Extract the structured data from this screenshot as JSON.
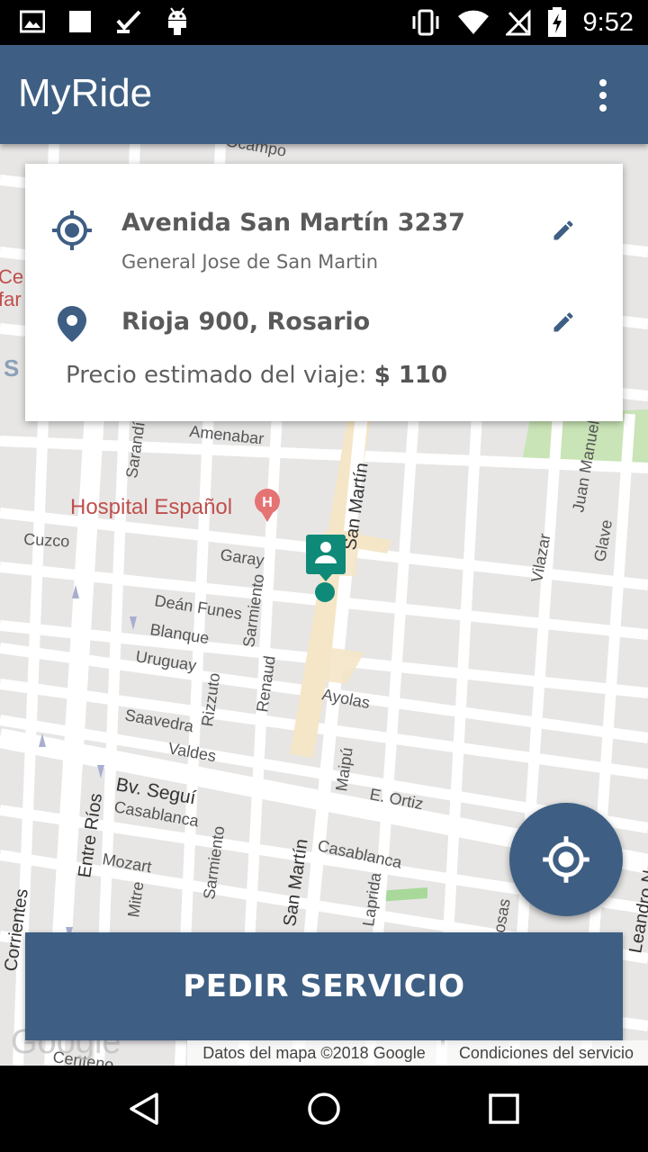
{
  "status_bar": {
    "time": "9:52",
    "left_icons": [
      "image-icon",
      "square-icon",
      "check-icon",
      "android-icon"
    ],
    "right_icons": [
      "vibrate-icon",
      "wifi-icon",
      "no-signal-icon",
      "battery-charging-icon"
    ]
  },
  "app_bar": {
    "title": "MyRide",
    "menu_icon": "more-vert-icon"
  },
  "trip_card": {
    "origin": {
      "address": "Avenida San Martín 3237",
      "subtitle": "General Jose de San Martin",
      "icon": "my-location-icon",
      "edit_icon": "edit-icon"
    },
    "destination": {
      "address": "Rioja 900, Rosario",
      "icon": "place-pin-icon",
      "edit_icon": "edit-icon"
    },
    "price_label": "Precio estimado del viaje:",
    "price_value": "$ 110"
  },
  "map": {
    "streets": [
      "Amenabar",
      "Cuzco",
      "Garay",
      "Deán Funes",
      "Blanque",
      "Uruguay",
      "Saavedra",
      "Valdes",
      "Bv. Seguí",
      "Casablanca",
      "Mozart",
      "Casablanca",
      "Ayolas",
      "E. Ortiz",
      "Maipú",
      "Laprida",
      "San Martín",
      "Sarmiento",
      "Rizzuto",
      "Renaud",
      "Entre Ríos",
      "Mitre",
      "Corrientes",
      "Vilazar",
      "Glave",
      "Juan Manuel",
      "Leandro N",
      "Rosas",
      "Sarandí",
      "Ocampo",
      "Centeno",
      "S"
    ],
    "poi_label": "Hospital Español",
    "poi_badge": "H",
    "partial_labels": [
      "Ce",
      "far"
    ],
    "attribution": "Datos del mapa ©2018 Google",
    "terms": "Condiciones del servicio",
    "logo": "Google"
  },
  "actions": {
    "request_button": "PEDIR SERVICIO",
    "locate_icon": "my-location-icon"
  },
  "colors": {
    "primary": "#3e5f83",
    "map_bg": "#e7e6e5",
    "marker": "#0f8a78",
    "poi": "#c0504d"
  },
  "nav_bar": {
    "buttons": [
      "back-icon",
      "home-icon",
      "recents-icon"
    ]
  }
}
